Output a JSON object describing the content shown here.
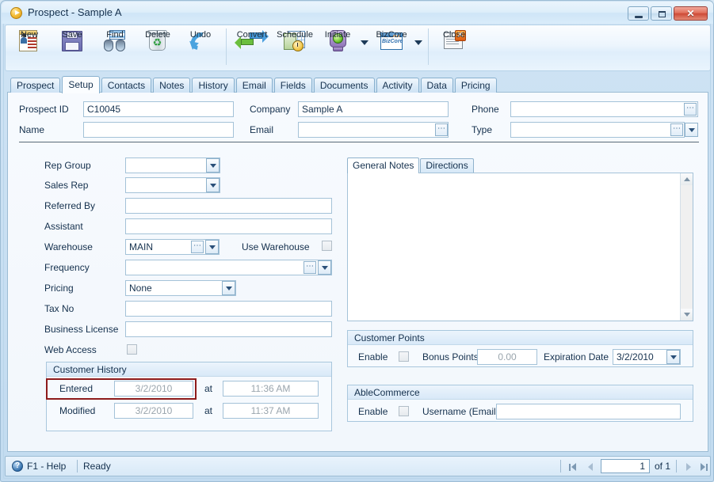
{
  "window": {
    "title": "Prospect - Sample A",
    "title_icon": "play-circle-icon",
    "minimize_label": "Minimize",
    "maximize_label": "Maximize",
    "close_label": "Close"
  },
  "toolbar": {
    "items": [
      {
        "label": "New",
        "icon": "new-record-icon"
      },
      {
        "label": "Save",
        "icon": "floppy-disk-icon"
      },
      {
        "label": "Find",
        "icon": "binoculars-icon"
      },
      {
        "label": "Delete",
        "icon": "recycle-bin-icon"
      },
      {
        "label": "Undo",
        "icon": "undo-arrow-icon"
      },
      {
        "label": "Convert",
        "icon": "convert-arrows-icon"
      },
      {
        "label": "Schedule",
        "icon": "calendar-clock-icon"
      },
      {
        "label": "Initiate",
        "icon": "traffic-light-icon"
      },
      {
        "label": "BizCore",
        "icon": "bizcore-window-icon",
        "badge": "BizCore"
      },
      {
        "label": "Close",
        "icon": "close-document-icon"
      }
    ]
  },
  "tabs": {
    "items": [
      "Prospect",
      "Setup",
      "Contacts",
      "Notes",
      "History",
      "Email",
      "Fields",
      "Documents",
      "Activity",
      "Data",
      "Pricing"
    ],
    "active": "Setup"
  },
  "header_fields": {
    "prospect_id": {
      "label": "Prospect ID",
      "value": "C10045"
    },
    "name": {
      "label": "Name",
      "value": ""
    },
    "company": {
      "label": "Company",
      "value": "Sample A"
    },
    "email": {
      "label": "Email",
      "value": ""
    },
    "phone": {
      "label": "Phone",
      "value": ""
    },
    "type": {
      "label": "Type",
      "value": ""
    }
  },
  "setup_fields": {
    "rep_group": {
      "label": "Rep Group",
      "value": ""
    },
    "sales_rep": {
      "label": "Sales Rep",
      "value": ""
    },
    "referred_by": {
      "label": "Referred By",
      "value": ""
    },
    "assistant": {
      "label": "Assistant",
      "value": ""
    },
    "warehouse": {
      "label": "Warehouse",
      "value": "MAIN"
    },
    "use_warehouse": {
      "label": "Use Warehouse",
      "checked": false
    },
    "frequency": {
      "label": "Frequency",
      "value": ""
    },
    "pricing": {
      "label": "Pricing",
      "value": "None"
    },
    "tax_no": {
      "label": "Tax No",
      "value": ""
    },
    "business_license": {
      "label": "Business License",
      "value": ""
    },
    "web_access": {
      "label": "Web Access",
      "checked": false
    }
  },
  "customer_history": {
    "title": "Customer History",
    "entered_label": "Entered",
    "entered_date": "3/2/2010",
    "entered_at_label": "at",
    "entered_time": "11:36 AM",
    "modified_label": "Modified",
    "modified_date": "3/2/2010",
    "modified_at_label": "at",
    "modified_time": "11:37 AM",
    "highlight_color": "#8e1b1b"
  },
  "notes_panel": {
    "tabs": [
      "General Notes",
      "Directions"
    ],
    "active": "General Notes",
    "content": ""
  },
  "customer_points": {
    "title": "Customer Points",
    "enable_label": "Enable",
    "enable_checked": false,
    "bonus_points_label": "Bonus Points",
    "bonus_points_value": "0.00",
    "expiration_label": "Expiration Date",
    "expiration_value": "3/2/2010"
  },
  "able_commerce": {
    "title": "AbleCommerce",
    "enable_label": "Enable",
    "enable_checked": false,
    "username_label": "Username (Email)",
    "username_value": ""
  },
  "statusbar": {
    "help": "F1 - Help",
    "status": "Ready",
    "page_value": "1",
    "of_label": "of 1",
    "first_label": "First",
    "prev_label": "Previous",
    "next_label": "Next",
    "last_label": "Last"
  }
}
